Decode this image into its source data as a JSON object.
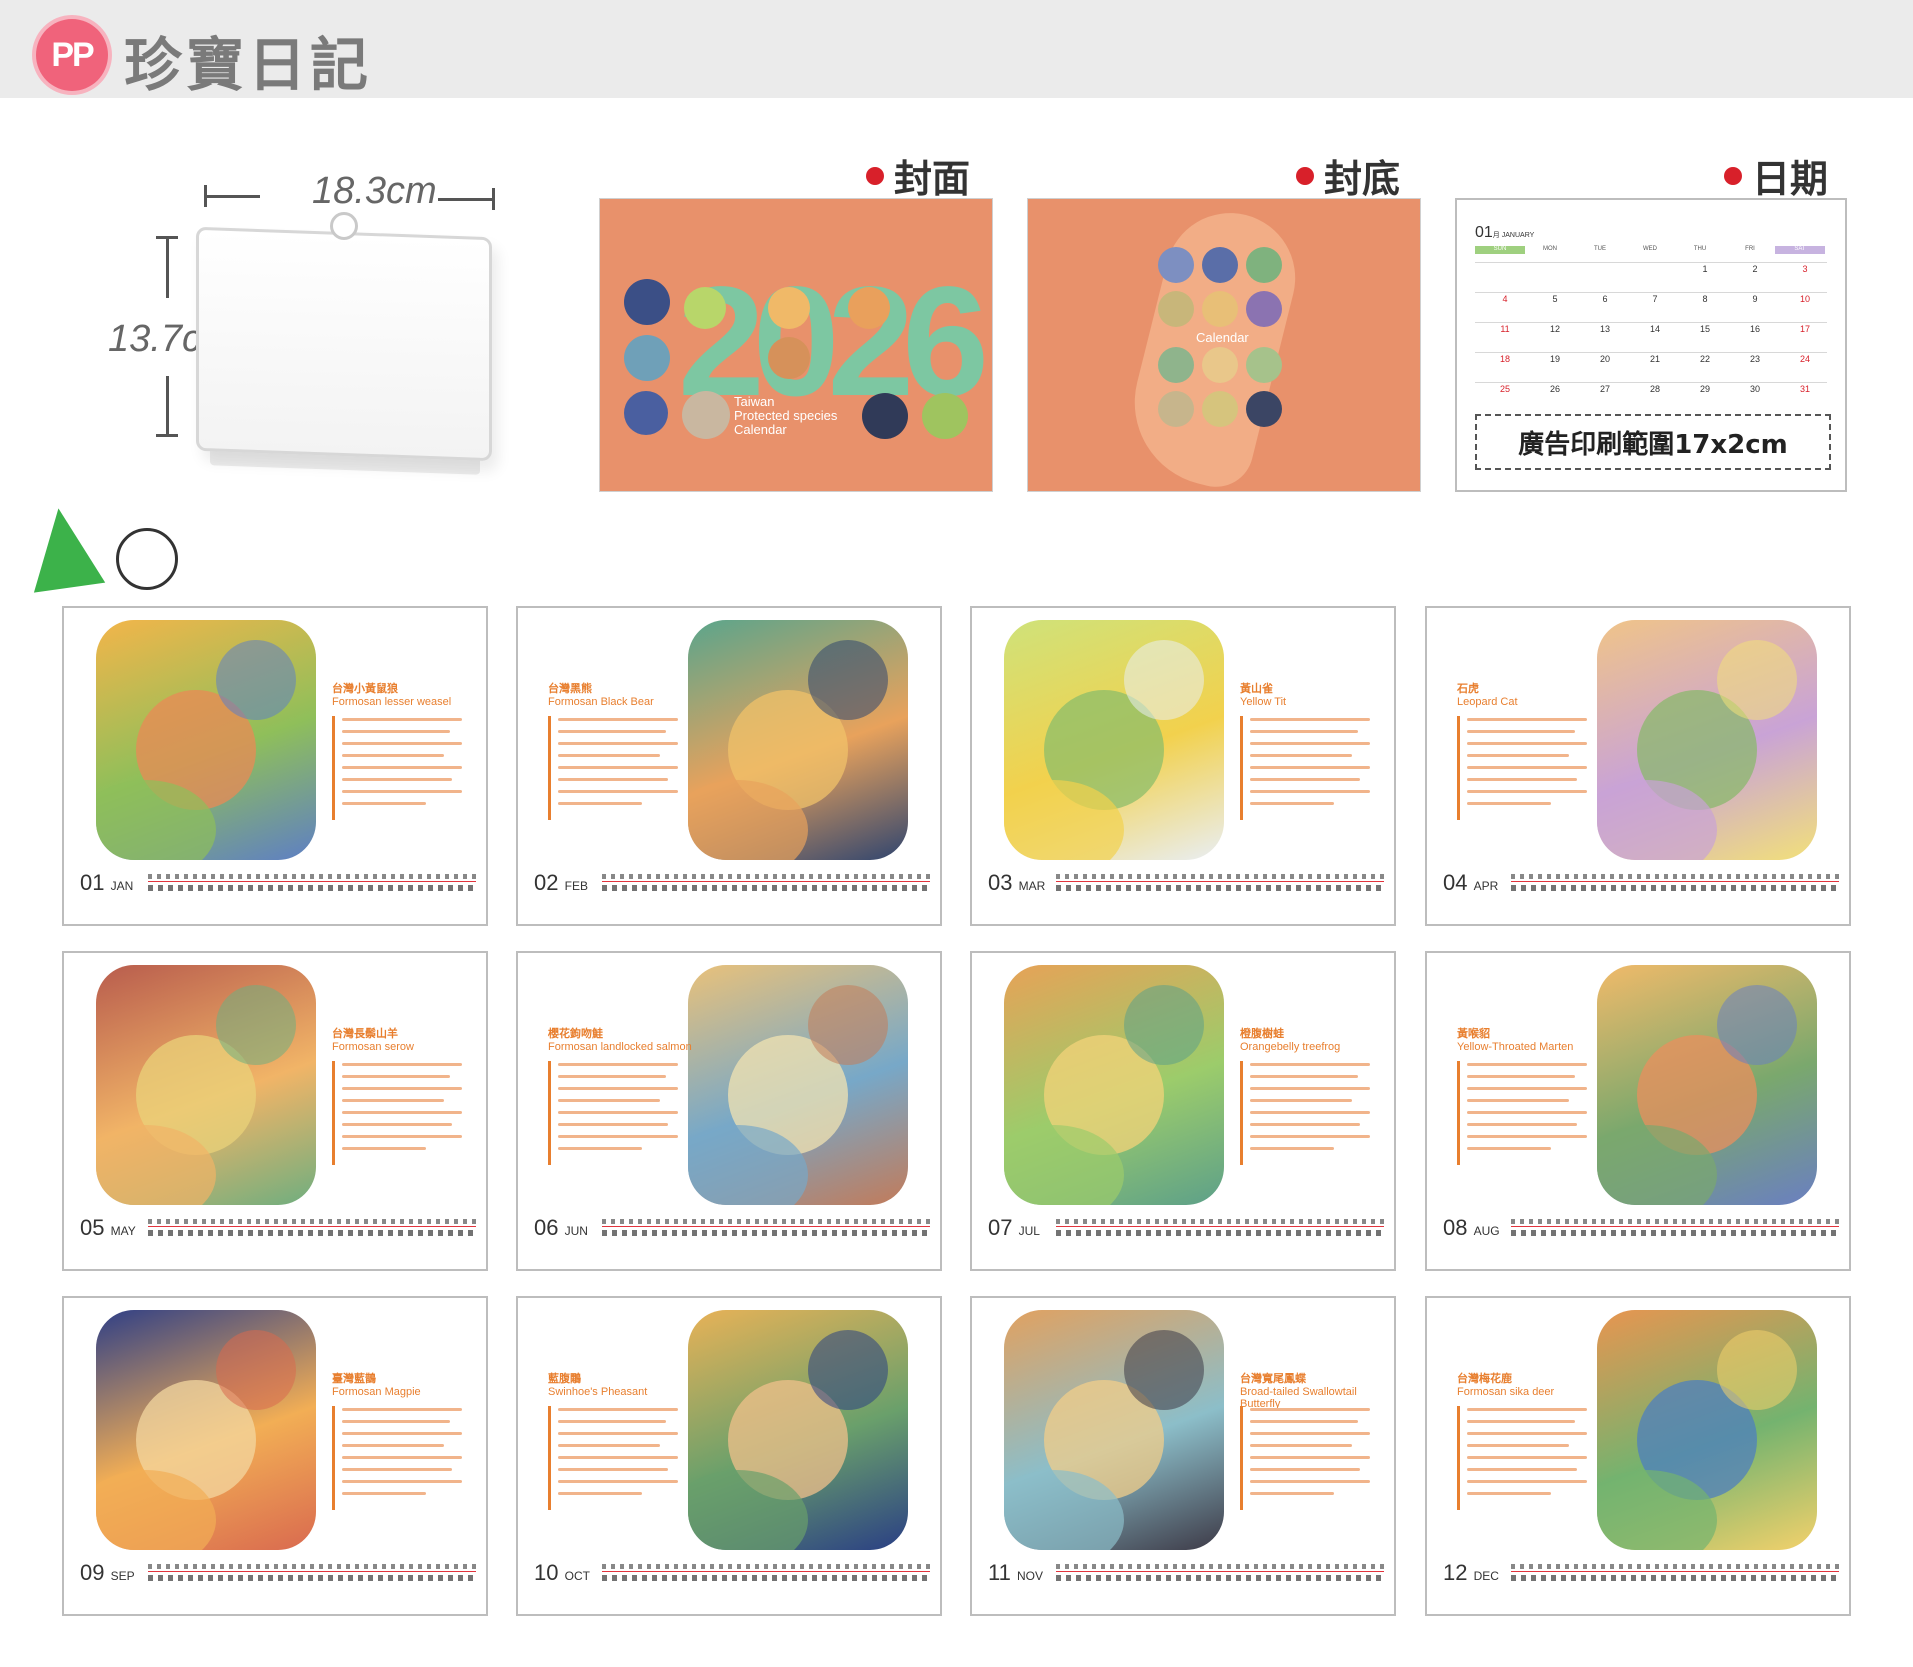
{
  "brand": {
    "logo_text": "PP",
    "name": "珍寶日記"
  },
  "product": {
    "width_label": "18.3cm",
    "height_label": "13.7cm"
  },
  "sections": {
    "front": "封面",
    "back": "封底",
    "date": "日期"
  },
  "cover": {
    "year": "2026",
    "caption_lines": [
      "Taiwan",
      "Protected species",
      "Calendar"
    ],
    "back_caption": "Calendar"
  },
  "date_card": {
    "month_num": "01",
    "month_name": "月 JANUARY",
    "weekdays": [
      "SUN",
      "MON",
      "TUE",
      "WED",
      "THU",
      "FRI",
      "SAT"
    ],
    "rows": [
      [
        "",
        "",
        "",
        "",
        "1",
        "2",
        "3"
      ],
      [
        "4",
        "5",
        "6",
        "7",
        "8",
        "9",
        "10"
      ],
      [
        "11",
        "12",
        "13",
        "14",
        "15",
        "16",
        "17"
      ],
      [
        "18",
        "19",
        "20",
        "21",
        "22",
        "23",
        "24"
      ],
      [
        "25",
        "26",
        "27",
        "28",
        "29",
        "30",
        "31"
      ]
    ],
    "ad_area": "廣告印刷範圍17x2cm"
  },
  "months": [
    {
      "num": "01",
      "abbr": "JAN",
      "cn": "台灣小黃鼠狼",
      "en": "Formosan lesser weasel",
      "art_side": "left",
      "colors": [
        "#f3b54a",
        "#8fbf5a",
        "#5e7fc4",
        "#e98a55"
      ]
    },
    {
      "num": "02",
      "abbr": "FEB",
      "cn": "台灣黑熊",
      "en": "Formosan Black Bear",
      "art_side": "right",
      "colors": [
        "#5aa58c",
        "#e8a25c",
        "#30456f",
        "#f0c16a"
      ]
    },
    {
      "num": "03",
      "abbr": "MAR",
      "cn": "黃山雀",
      "en": "Yellow Tit",
      "art_side": "left",
      "colors": [
        "#cfe27a",
        "#f2d14d",
        "#e9eef3",
        "#8cbd6a"
      ]
    },
    {
      "num": "04",
      "abbr": "APR",
      "cn": "石虎",
      "en": "Leopard Cat",
      "art_side": "right",
      "colors": [
        "#f0c488",
        "#c9a3d6",
        "#f2e07a",
        "#89b86c"
      ]
    },
    {
      "num": "05",
      "abbr": "MAY",
      "cn": "台灣長鬃山羊",
      "en": "Formosan serow",
      "art_side": "left",
      "colors": [
        "#b85c4d",
        "#f1b467",
        "#6fae7f",
        "#e9d27a"
      ]
    },
    {
      "num": "06",
      "abbr": "JUN",
      "cn": "櫻花鉤吻鮭",
      "en": "Formosan landlocked salmon",
      "art_side": "right",
      "colors": [
        "#e9c17a",
        "#77a8c8",
        "#c27b5a",
        "#f2e3b2"
      ]
    },
    {
      "num": "07",
      "abbr": "JUL",
      "cn": "橙腹樹蛙",
      "en": "Orangebelly treefrog",
      "art_side": "left",
      "colors": [
        "#e7a257",
        "#9ccc6b",
        "#5da089",
        "#f3d37a"
      ]
    },
    {
      "num": "08",
      "abbr": "AUG",
      "cn": "黃喉貂",
      "en": "Yellow-Throated Marten",
      "art_side": "right",
      "colors": [
        "#f1ba6a",
        "#7aa86d",
        "#6a7fc1",
        "#e98f5e"
      ]
    },
    {
      "num": "09",
      "abbr": "SEP",
      "cn": "臺灣藍鵲",
      "en": "Formosan Magpie",
      "art_side": "left",
      "colors": [
        "#2f3f86",
        "#f2ae55",
        "#d96a4f",
        "#f3d7a0"
      ]
    },
    {
      "num": "10",
      "abbr": "OCT",
      "cn": "藍腹鷴",
      "en": "Swinhoe's Pheasant",
      "art_side": "right",
      "colors": [
        "#e8b257",
        "#6aa06b",
        "#2a3f84",
        "#f0c08b"
      ]
    },
    {
      "num": "11",
      "abbr": "NOV",
      "cn": "台灣寬尾鳳蝶",
      "en": "Broad-tailed Swallowtail Butterfly",
      "art_side": "left",
      "colors": [
        "#e1a160",
        "#8cbec9",
        "#3d3a47",
        "#f2cd8a"
      ]
    },
    {
      "num": "12",
      "abbr": "DEC",
      "cn": "台灣梅花鹿",
      "en": "Formosan sika deer",
      "art_side": "right",
      "colors": [
        "#e89550",
        "#74b36f",
        "#f3d16b",
        "#4d7fbf"
      ]
    }
  ]
}
